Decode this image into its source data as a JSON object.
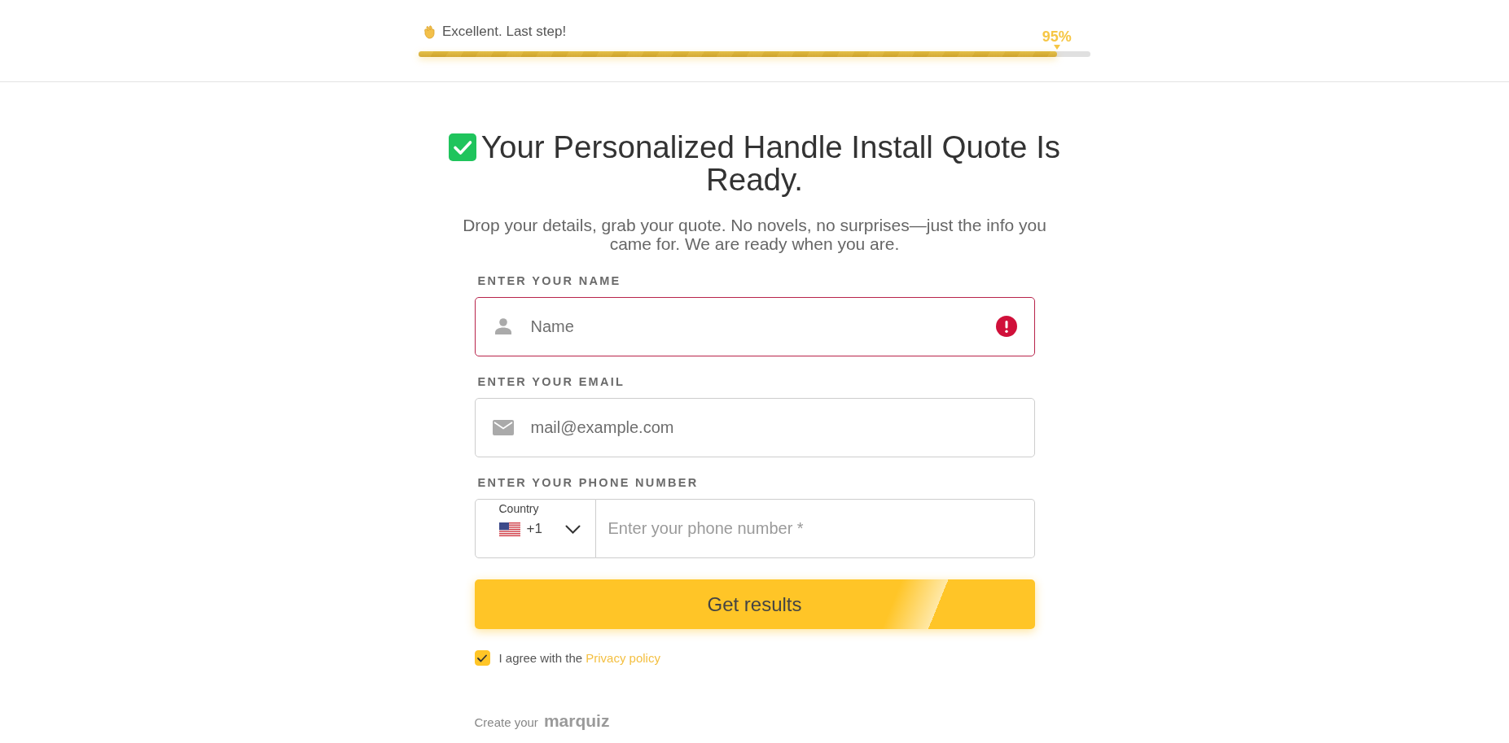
{
  "progress": {
    "label": "Excellent. Last step!",
    "percent_text": "95%",
    "level": 0.95
  },
  "heading": "Your Personalized Handle Install Quote Is Ready.",
  "subtitle": "Drop your details, grab your quote. No novels, no surprises—just the info you came for. We are ready when you are.",
  "fields": [
    {
      "kind": "name",
      "label": "ENTER YOUR NAME",
      "placeholder": "Name",
      "error": true
    },
    {
      "kind": "email",
      "label": "ENTER YOUR EMAIL",
      "placeholder": "mail@example.com",
      "error": false
    },
    {
      "kind": "phone",
      "label": "ENTER YOUR PHONE NUMBER",
      "placeholder": "Enter your phone number *",
      "error": false,
      "country": {
        "label": "Country",
        "code": "+1"
      }
    }
  ],
  "submit_button": "Get results",
  "consent": {
    "checked": true,
    "text": "I agree with the",
    "link": "Privacy policy"
  },
  "footer": {
    "text": "Create your",
    "logo": "marquiz"
  }
}
